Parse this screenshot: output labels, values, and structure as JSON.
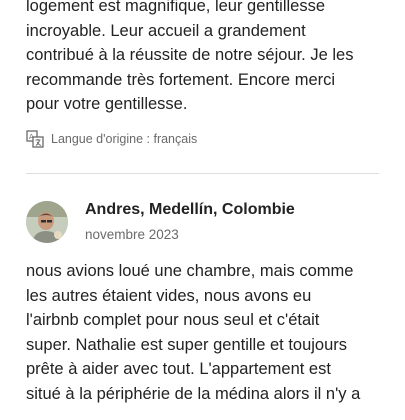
{
  "review_1": {
    "text": "logement est magnifique, leur gentillesse\nincroyable. Leur accueil a grandement\ncontribué à la réussite de notre séjour. Je les\nrecommande très fortement. Encore merci\npour votre gentillesse.",
    "translation_note": "Langue d'origine : français",
    "translation_icon": "translate-icon"
  },
  "review_2": {
    "reviewer_name": "Andres, Medellín, Colombie",
    "date": "novembre 2023",
    "avatar_icon": "reviewer-photo",
    "text": "nous avions loué une chambre, mais comme\nles autres étaient vides, nous avons eu\nl'airbnb complet pour nous seul et c'était\nsuper. Nathalie est super gentille et toujours\nprête à aider avec tout. L'appartement est\nsitué à la périphérie de la médina alors il n'y a"
  },
  "colors": {
    "text_primary": "#222222",
    "text_secondary": "#6a6a6a",
    "divider": "#dddddd"
  }
}
